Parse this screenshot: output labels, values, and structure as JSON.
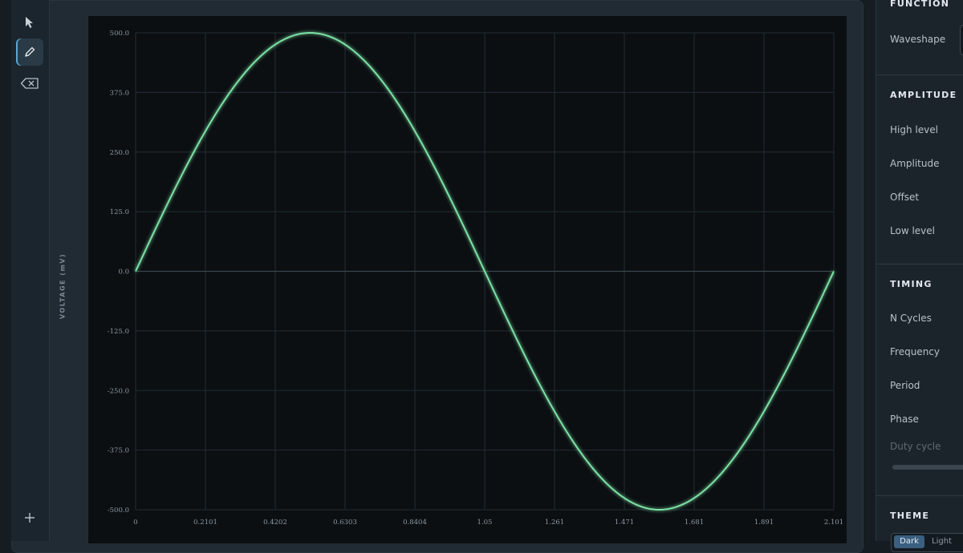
{
  "toolbar": {
    "tools": [
      {
        "name": "select",
        "icon": "cursor-arrow-icon",
        "active": false
      },
      {
        "name": "draw",
        "icon": "pencil-icon",
        "active": true
      },
      {
        "name": "erase",
        "icon": "eraser-icon",
        "active": false
      }
    ],
    "add_icon": "plus-icon"
  },
  "chart_data": {
    "type": "line",
    "title": "",
    "xlabel": "",
    "ylabel": "VOLTAGE (mV)",
    "xlim": [
      0,
      2.101
    ],
    "ylim": [
      -500,
      500
    ],
    "x_ticks": [
      "0",
      "0.2101",
      "0.4202",
      "0.6303",
      "0.8404",
      "1.05",
      "1.261",
      "1.471",
      "1.681",
      "1.891",
      "2.101"
    ],
    "y_ticks": [
      "500.0",
      "375.0",
      "250.0",
      "125.0",
      "0.0",
      "-125.0",
      "-250.0",
      "-375.0",
      "-500.0"
    ],
    "grid": true,
    "series": [
      {
        "color": "#7ce0a4",
        "waveform": "sine",
        "amplitude": 500,
        "offset": 0,
        "period": 2.101,
        "phase": 0,
        "x": [
          0,
          0.2101,
          0.4202,
          0.52525,
          0.6303,
          0.8404,
          1.0505,
          1.2606,
          1.4707,
          1.57575,
          1.6808,
          1.8909,
          2.101
        ],
        "y": [
          0,
          293.9,
          475.5,
          500,
          475.5,
          293.9,
          0,
          -293.9,
          -475.5,
          -500,
          -475.5,
          -293.9,
          0
        ]
      }
    ]
  },
  "panel": {
    "function": {
      "title": "FUNCTION",
      "waveshape_label": "Waveshape"
    },
    "amplitude": {
      "title": "AMPLITUDE",
      "rows": [
        "High level",
        "Amplitude",
        "Offset",
        "Low level"
      ]
    },
    "timing": {
      "title": "TIMING",
      "rows": [
        "N Cycles",
        "Frequency",
        "Period",
        "Phase"
      ],
      "duty_cycle_label": "Duty cycle",
      "duty_cycle_enabled": false
    },
    "theme": {
      "title": "THEME",
      "options": [
        "Dark",
        "Light"
      ],
      "selected": "Dark"
    }
  }
}
